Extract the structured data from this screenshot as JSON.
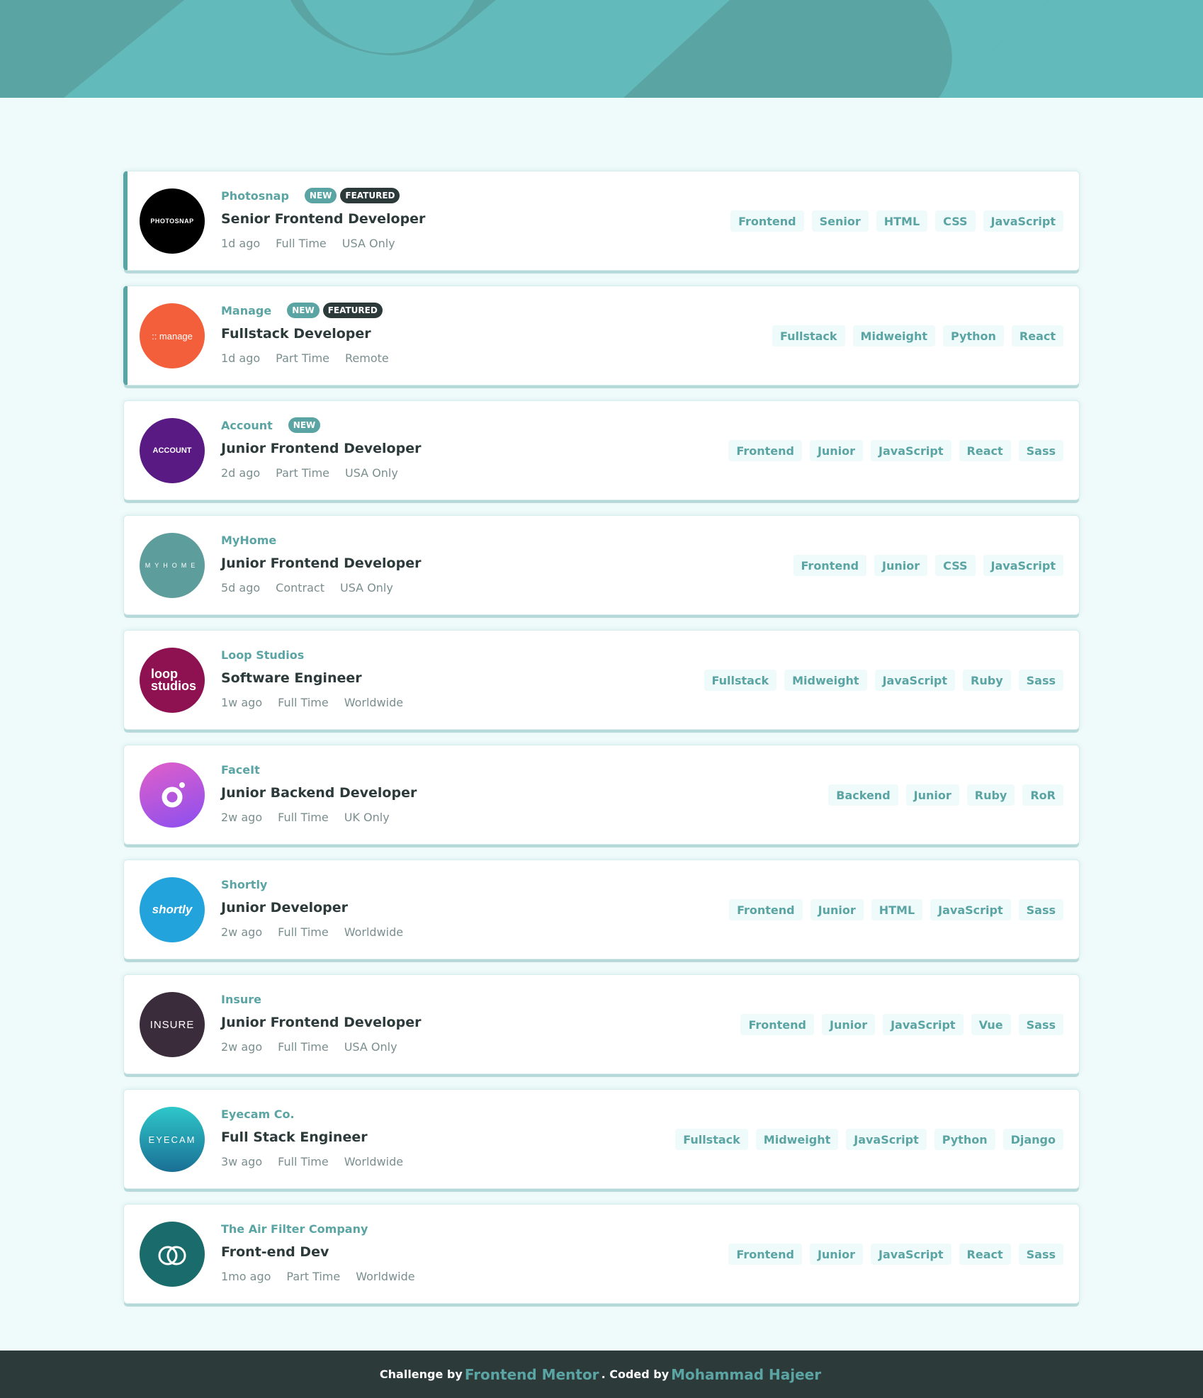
{
  "colors": {
    "primary": "#5ba4a4",
    "background": "#effafa",
    "tag_background": "#effafa",
    "dark": "#2c3a3a",
    "muted": "#7b8e8e"
  },
  "jobs": [
    {
      "company": "Photosnap",
      "new": true,
      "featured": true,
      "position": "Senior Frontend Developer",
      "posted_at": "1d ago",
      "contract": "Full Time",
      "location": "USA Only",
      "tags": [
        "Frontend",
        "Senior",
        "HTML",
        "CSS",
        "JavaScript"
      ],
      "logo_text": "PHOTOSNAP",
      "logo_color": "#000000"
    },
    {
      "company": "Manage",
      "new": true,
      "featured": true,
      "position": "Fullstack Developer",
      "posted_at": "1d ago",
      "contract": "Part Time",
      "location": "Remote",
      "tags": [
        "Fullstack",
        "Midweight",
        "Python",
        "React"
      ],
      "logo_text": ":: manage",
      "logo_color": "#f25f3a"
    },
    {
      "company": "Account",
      "new": true,
      "featured": false,
      "position": "Junior Frontend Developer",
      "posted_at": "2d ago",
      "contract": "Part Time",
      "location": "USA Only",
      "tags": [
        "Frontend",
        "Junior",
        "JavaScript",
        "React",
        "Sass"
      ],
      "logo_text": "ACCOUNT",
      "logo_color": "#5a1a84"
    },
    {
      "company": "MyHome",
      "new": false,
      "featured": false,
      "position": "Junior Frontend Developer",
      "posted_at": "5d ago",
      "contract": "Contract",
      "location": "USA Only",
      "tags": [
        "Frontend",
        "Junior",
        "CSS",
        "JavaScript"
      ],
      "logo_text": "MYHOME",
      "logo_color": "#5d9d9b"
    },
    {
      "company": "Loop Studios",
      "new": false,
      "featured": false,
      "position": "Software Engineer",
      "posted_at": "1w ago",
      "contract": "Full Time",
      "location": "Worldwide",
      "tags": [
        "Fullstack",
        "Midweight",
        "JavaScript",
        "Ruby",
        "Sass"
      ],
      "logo_text": "loop studios",
      "logo_color": "#8e1152"
    },
    {
      "company": "FaceIt",
      "new": false,
      "featured": false,
      "position": "Junior Backend Developer",
      "posted_at": "2w ago",
      "contract": "Full Time",
      "location": "UK Only",
      "tags": [
        "Backend",
        "Junior",
        "Ruby",
        "RoR"
      ],
      "logo_text": "",
      "logo_color": "#b14fe0"
    },
    {
      "company": "Shortly",
      "new": false,
      "featured": false,
      "position": "Junior Developer",
      "posted_at": "2w ago",
      "contract": "Full Time",
      "location": "Worldwide",
      "tags": [
        "Frontend",
        "Junior",
        "HTML",
        "JavaScript",
        "Sass"
      ],
      "logo_text": "shortly",
      "logo_color": "#22a3dc"
    },
    {
      "company": "Insure",
      "new": false,
      "featured": false,
      "position": "Junior Frontend Developer",
      "posted_at": "2w ago",
      "contract": "Full Time",
      "location": "USA Only",
      "tags": [
        "Frontend",
        "Junior",
        "JavaScript",
        "Vue",
        "Sass"
      ],
      "logo_text": "INSURE",
      "logo_color": "#3b2c3c"
    },
    {
      "company": "Eyecam Co.",
      "new": false,
      "featured": false,
      "position": "Full Stack Engineer",
      "posted_at": "3w ago",
      "contract": "Full Time",
      "location": "Worldwide",
      "tags": [
        "Fullstack",
        "Midweight",
        "JavaScript",
        "Python",
        "Django"
      ],
      "logo_text": "EYECAM",
      "logo_color": "#1f8ea3"
    },
    {
      "company": "The Air Filter Company",
      "new": false,
      "featured": false,
      "position": "Front-end Dev",
      "posted_at": "1mo ago",
      "contract": "Part Time",
      "location": "Worldwide",
      "tags": [
        "Frontend",
        "Junior",
        "JavaScript",
        "React",
        "Sass"
      ],
      "logo_text": "",
      "logo_color": "#1a6b6b"
    }
  ],
  "badges": {
    "new": "NEW",
    "featured": "FEATURED"
  },
  "footer": {
    "challenge_text": "Challenge by",
    "challenge_link": "Frontend Mentor",
    "coded_text": ". Coded by",
    "coded_link": "Mohammad Hajeer"
  }
}
